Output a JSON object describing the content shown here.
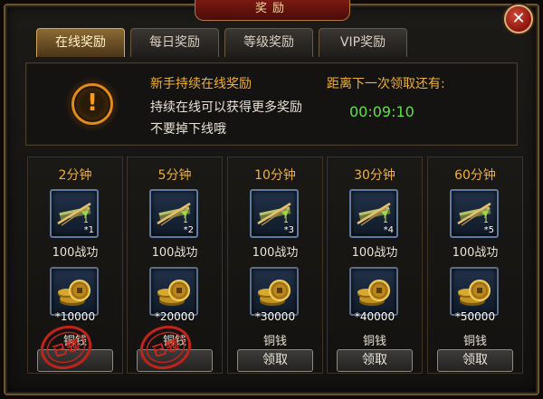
{
  "window": {
    "title": "奖励",
    "close_label": "✕"
  },
  "tabs": [
    {
      "label": "在线奖励",
      "active": true
    },
    {
      "label": "每日奖励",
      "active": false
    },
    {
      "label": "等级奖励",
      "active": false
    },
    {
      "label": "VIP奖励",
      "active": false
    }
  ],
  "info": {
    "title": "新手持续在线奖励",
    "line1": "持续在线可以获得更多奖励",
    "line2": "不要掉下线哦",
    "countdown_label": "距离下一次领取还有:",
    "countdown": "00:09:10",
    "icon_glyph": "!"
  },
  "rewards": [
    {
      "time": "2分钟",
      "item_count": "*1",
      "item_label": "100战功",
      "coin_amount": "*10000",
      "coin_label": "铜钱",
      "claimed": true,
      "button_label": "",
      "stamp_text": "已领"
    },
    {
      "time": "5分钟",
      "item_count": "*2",
      "item_label": "100战功",
      "coin_amount": "*20000",
      "coin_label": "铜钱",
      "claimed": true,
      "button_label": "",
      "stamp_text": "已领"
    },
    {
      "time": "10分钟",
      "item_count": "*3",
      "item_label": "100战功",
      "coin_amount": "*30000",
      "coin_label": "铜钱",
      "claimed": false,
      "button_label": "领取"
    },
    {
      "time": "30分钟",
      "item_count": "*4",
      "item_label": "100战功",
      "coin_amount": "*40000",
      "coin_label": "铜钱",
      "claimed": false,
      "button_label": "领取"
    },
    {
      "time": "60分钟",
      "item_count": "*5",
      "item_label": "100战功",
      "coin_amount": "*50000",
      "coin_label": "铜钱",
      "claimed": false,
      "button_label": "领取"
    }
  ],
  "colors": {
    "accent": "#f0b030",
    "timer": "#5fe046",
    "stamp": "#c0231a"
  }
}
